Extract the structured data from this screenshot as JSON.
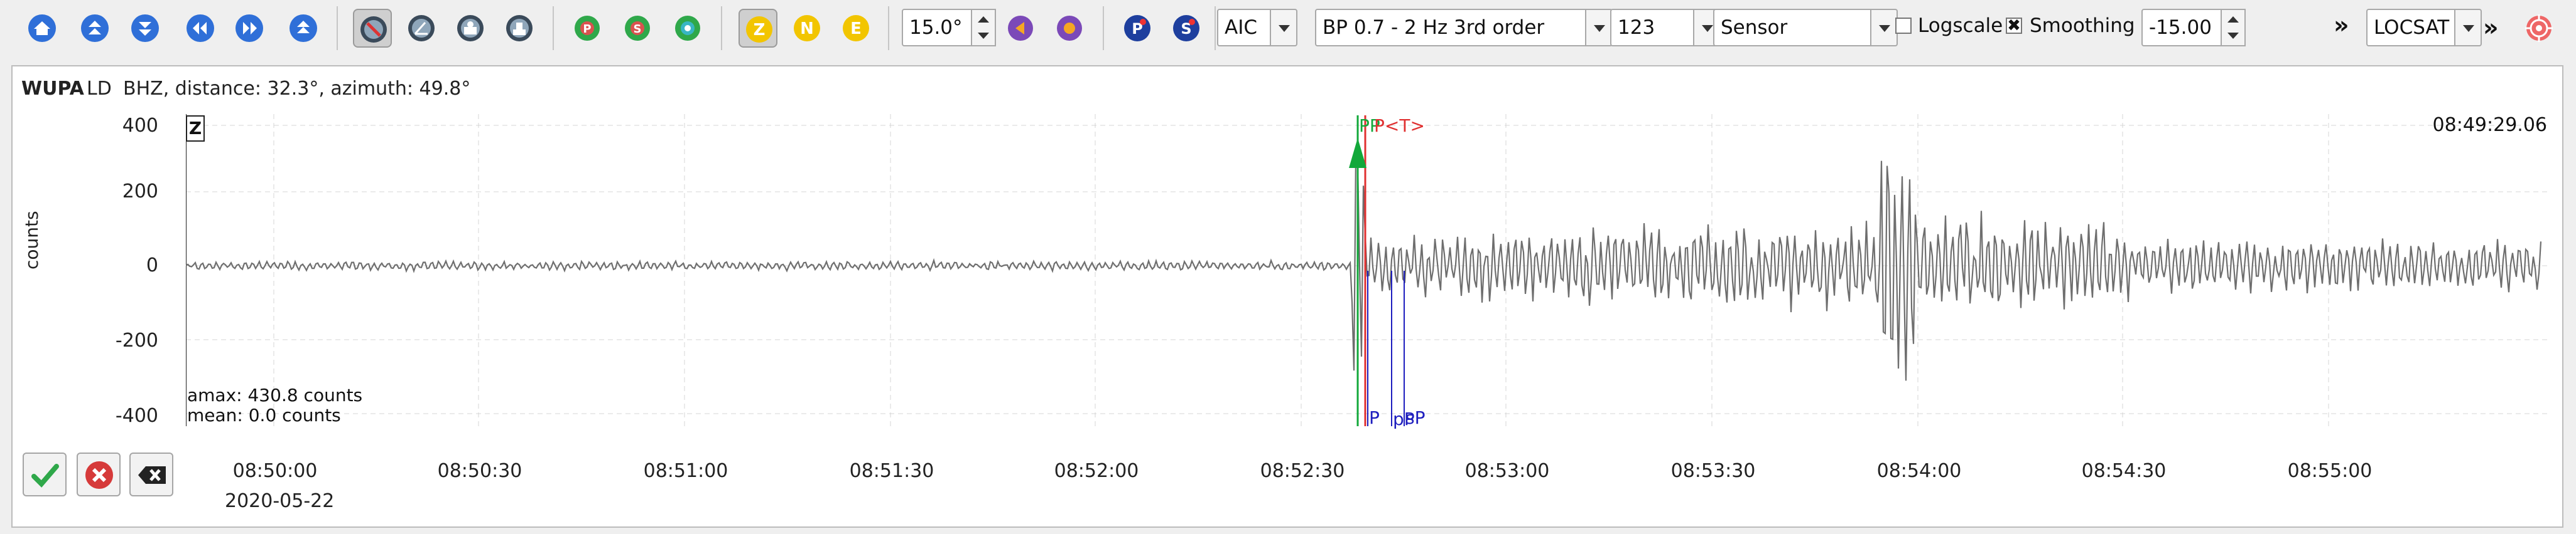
{
  "toolbar": {
    "angle_value": "15.0°",
    "picker_method": "AIC",
    "filter": "BP 0.7 - 2 Hz  3rd order",
    "number_value": "123",
    "unit": "Sensor",
    "logscale_label": "Logscale",
    "logscale_checked": false,
    "smoothing_label": "Smoothing",
    "smoothing_checked": true,
    "offset_value": "-15.00",
    "locator": "LOCSAT",
    "overflow_glyph": "»",
    "components": [
      "Z",
      "N",
      "E"
    ],
    "phases": [
      "P",
      "S"
    ]
  },
  "trace": {
    "station": "WUPA",
    "network": "LD",
    "info": "BHZ, distance: 32.3°, azimuth: 49.8°",
    "component": "Z",
    "timestamp": "08:49:29.06",
    "amax": "amax: 430.8 counts",
    "mean": "mean: 0.0 counts",
    "ylabel": "counts",
    "yticks": [
      "400",
      "200",
      "0",
      "-200",
      "-400"
    ],
    "xticks": [
      "08:50:00",
      "08:50:30",
      "08:51:00",
      "08:51:30",
      "08:52:00",
      "08:52:30",
      "08:53:00",
      "08:53:30",
      "08:54:00",
      "08:54:30",
      "08:55:00"
    ],
    "date": "2020-05-22",
    "picks_top": {
      "pp": "PP",
      "p_t": "P<T>"
    },
    "picks_bottom": {
      "p": "P",
      "pp": "pP",
      "sp": "sP"
    }
  },
  "colors": {
    "waveform": "#6e6e6e",
    "pick_green": "#12a83a",
    "pick_red": "#e03030",
    "theory_blue": "#1d1dbe",
    "zne_yellow": "#f2c500",
    "nav_blue": "#2f6fd8"
  },
  "icons": {
    "nav": [
      "home-icon",
      "scroll-up-icon",
      "scroll-down-icon",
      "scroll-left-icon",
      "scroll-right-icon",
      "scroll-top-icon"
    ],
    "tools": [
      "pick-tool-icon",
      "angle-tool-icon",
      "record-tool-icon",
      "station-tool-icon"
    ],
    "actions": [
      "accept-icon",
      "reject-icon",
      "delete-pick-icon"
    ],
    "target": "target-icon"
  }
}
